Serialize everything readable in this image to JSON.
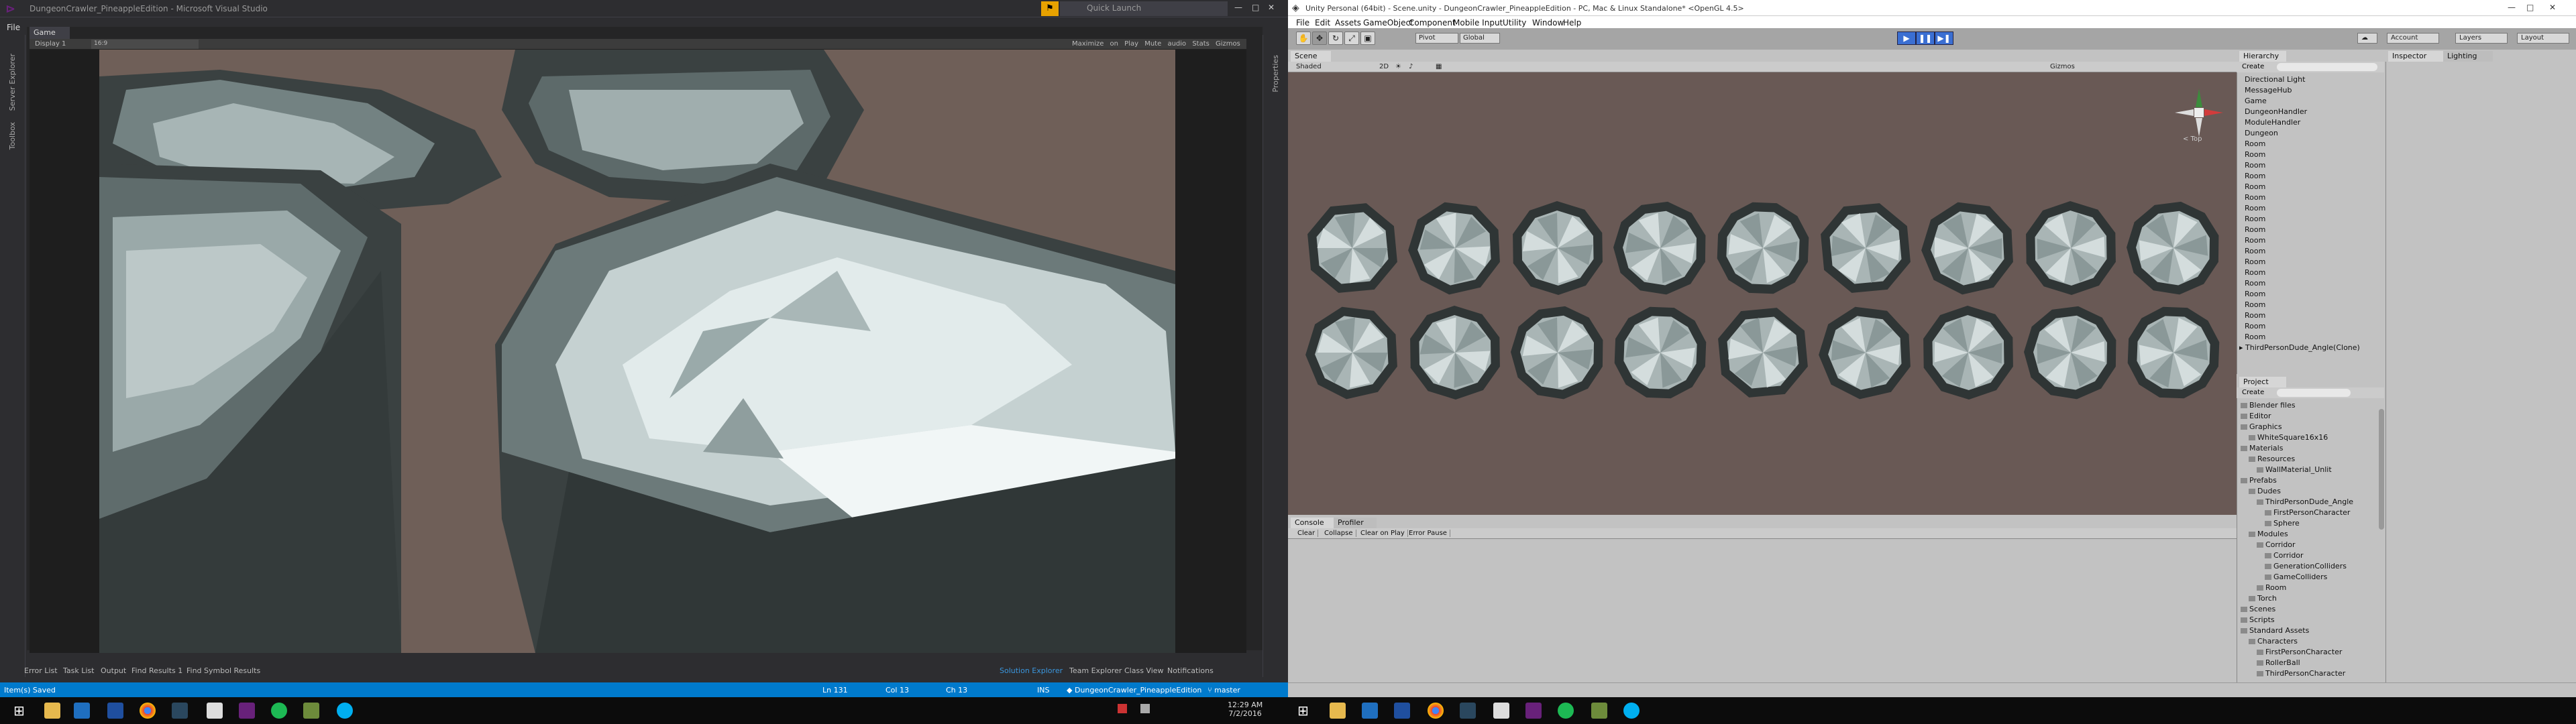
{
  "colors": {
    "vs_accent": "#007acc",
    "vs_bg": "#2d2d30",
    "unity_bg": "#c2c2c2",
    "unity_play": "#3b6fd2",
    "scene_bg": "#695955",
    "game_bg": "#6f5f58"
  },
  "vs": {
    "title": "DungeonCrawler_PineappleEdition - Microsoft Visual Studio",
    "quick_launch": "Quick Launch",
    "menu_file": "File",
    "doc_tab": "Game",
    "display": "Display 1",
    "aspect": "16:9",
    "game_options": "Maximize on Play   Mute audio   Stats   Gizmos",
    "left_vtabs": [
      "Server Explorer",
      "Toolbox"
    ],
    "right_vtabs": [
      "Properties"
    ],
    "bottom_tabs_left": [
      "Error List",
      "Task List",
      "Output",
      "Find Results 1",
      "Find Symbol Results"
    ],
    "bottom_tabs_right": [
      "Solution Explorer",
      "Team Explorer",
      "Class View",
      "Notifications"
    ],
    "status": {
      "left": "Item(s) Saved",
      "ln": "Ln 131",
      "col": "Col 13",
      "ch": "Ch 13",
      "ins": "INS",
      "project": "DungeonCrawler_PineappleEdition",
      "branch": "master"
    }
  },
  "taskbar": {
    "time": "12:29 AM",
    "date": "7/2/2016"
  },
  "unity": {
    "title": "Unity Personal (64bit) - Scene.unity - DungeonCrawler_PineappleEdition - PC, Mac & Linux Standalone* <OpenGL 4.5>",
    "menu": [
      "File",
      "Edit",
      "Assets",
      "GameObject",
      "Component",
      "Mobile Input",
      "Utility",
      "Window",
      "Help"
    ],
    "pivot": "Pivot",
    "global": "Global",
    "right_buttons": [
      "Account",
      "Layers",
      "Layout"
    ],
    "scene_tab": "Scene",
    "scene_shading": "Shaded",
    "scene_mode": "2D",
    "scene_gizmos": "Gizmos",
    "gizmo_label": "< Top",
    "hierarchy_tab": "Hierarchy",
    "create": "Create",
    "hierarchy": [
      "Directional Light",
      "MessageHub",
      "Game",
      "DungeonHandler",
      "ModuleHandler",
      "Dungeon",
      "Room",
      "Room",
      "Room",
      "Room",
      "Room",
      "Room",
      "Room",
      "Room",
      "Room",
      "Room",
      "Room",
      "Room",
      "Room",
      "Room",
      "Room",
      "Room",
      "Room",
      "Room",
      "Room",
      "▸ ThirdPersonDude_Angle(Clone)"
    ],
    "project_tab": "Project",
    "project": [
      {
        "label": "Blender files",
        "indent": 0
      },
      {
        "label": "Editor",
        "indent": 0
      },
      {
        "label": "Graphics",
        "indent": 0
      },
      {
        "label": "WhiteSquare16x16",
        "indent": 1
      },
      {
        "label": "Materials",
        "indent": 0
      },
      {
        "label": "Resources",
        "indent": 1
      },
      {
        "label": "WallMaterial_Unlit",
        "indent": 2
      },
      {
        "label": "Prefabs",
        "indent": 0
      },
      {
        "label": "Dudes",
        "indent": 1
      },
      {
        "label": "ThirdPersonDude_Angle",
        "indent": 2
      },
      {
        "label": "FirstPersonCharacter",
        "indent": 3
      },
      {
        "label": "Sphere",
        "indent": 3
      },
      {
        "label": "Modules",
        "indent": 1
      },
      {
        "label": "Corridor",
        "indent": 2
      },
      {
        "label": "Corridor",
        "indent": 3
      },
      {
        "label": "GenerationColliders",
        "indent": 3
      },
      {
        "label": "GameColliders",
        "indent": 3
      },
      {
        "label": "Room",
        "indent": 2
      },
      {
        "label": "Torch",
        "indent": 1
      },
      {
        "label": "Scenes",
        "indent": 0
      },
      {
        "label": "Scripts",
        "indent": 0
      },
      {
        "label": "Standard Assets",
        "indent": 0
      },
      {
        "label": "Characters",
        "indent": 1
      },
      {
        "label": "FirstPersonCharacter",
        "indent": 2
      },
      {
        "label": "RollerBall",
        "indent": 2
      },
      {
        "label": "ThirdPersonCharacter",
        "indent": 2
      }
    ],
    "inspector_tab": "Inspector",
    "lighting_tab": "Lighting",
    "console_tab": "Console",
    "profiler_tab": "Profiler",
    "console_buttons": [
      "Clear",
      "Collapse",
      "Clear on Play",
      "Error Pause"
    ]
  }
}
